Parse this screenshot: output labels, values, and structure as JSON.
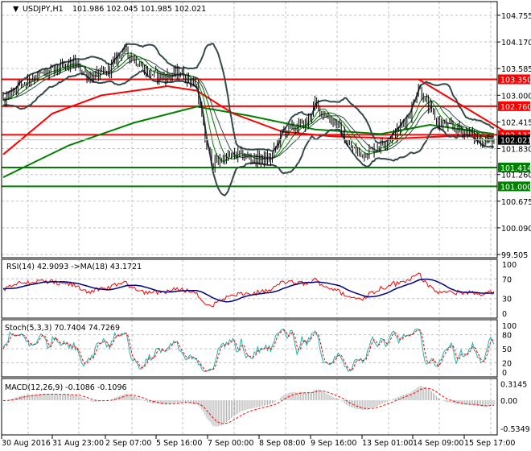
{
  "header": {
    "symbol": "USDJPY,H1",
    "ohlc": "101.986 102.045 101.985 102.021"
  },
  "chart_data": {
    "type": "candlestick",
    "symbol": "USDJPY",
    "timeframe": "H1",
    "price_axis": {
      "ticks": [
        "104.755",
        "104.170",
        "103.585",
        "103.000",
        "102.415",
        "101.830",
        "101.260",
        "100.675",
        "100.090",
        "99.505"
      ],
      "range": [
        99.505,
        104.755
      ]
    },
    "time_axis": [
      "30 Aug 2016",
      "31 Aug 23:00",
      "2 Sep 07:00",
      "5 Sep 16:00",
      "7 Sep 00:00",
      "8 Sep 08:00",
      "9 Sep 16:00",
      "13 Sep 01:00",
      "14 Sep 09:00",
      "15 Sep 17:00"
    ],
    "price_path": [
      [
        0,
        102.9
      ],
      [
        8,
        103.2
      ],
      [
        18,
        103.4
      ],
      [
        28,
        103.5
      ],
      [
        43,
        103.7
      ],
      [
        53,
        103.4
      ],
      [
        63,
        103.5
      ],
      [
        73,
        104.0
      ],
      [
        80,
        103.8
      ],
      [
        88,
        103.5
      ],
      [
        98,
        103.4
      ],
      [
        108,
        103.5
      ],
      [
        118,
        103.2
      ],
      [
        123,
        102.0
      ],
      [
        128,
        101.5
      ],
      [
        133,
        101.6
      ],
      [
        143,
        101.7
      ],
      [
        153,
        101.6
      ],
      [
        163,
        101.6
      ],
      [
        170,
        102.2
      ],
      [
        178,
        102.3
      ],
      [
        185,
        102.4
      ],
      [
        190,
        102.8
      ],
      [
        198,
        102.5
      ],
      [
        203,
        102.4
      ],
      [
        210,
        101.9
      ],
      [
        218,
        101.7
      ],
      [
        225,
        101.8
      ],
      [
        233,
        102.0
      ],
      [
        240,
        102.2
      ],
      [
        248,
        102.6
      ],
      [
        253,
        103.2
      ],
      [
        258,
        102.8
      ],
      [
        265,
        102.4
      ],
      [
        273,
        102.3
      ],
      [
        283,
        102.2
      ],
      [
        290,
        102.0
      ],
      [
        299,
        102.02
      ]
    ],
    "ma_red": [
      [
        0,
        101.7
      ],
      [
        30,
        102.6
      ],
      [
        60,
        103.0
      ],
      [
        100,
        103.2
      ],
      [
        118,
        103.1
      ],
      [
        140,
        102.6
      ],
      [
        170,
        102.2
      ],
      [
        200,
        102.1
      ],
      [
        240,
        102.05
      ],
      [
        270,
        102.1
      ],
      [
        299,
        102.1
      ]
    ],
    "ma_green": [
      [
        0,
        101.2
      ],
      [
        40,
        101.9
      ],
      [
        80,
        102.4
      ],
      [
        118,
        102.75
      ],
      [
        150,
        102.55
      ],
      [
        190,
        102.25
      ],
      [
        230,
        102.15
      ],
      [
        260,
        102.35
      ],
      [
        299,
        102.15
      ]
    ],
    "levels": [
      {
        "price": 103.35,
        "label": "103.350",
        "color": "#ff0000"
      },
      {
        "price": 102.76,
        "label": "102.760",
        "color": "#ff0000"
      },
      {
        "price": 102.132,
        "label": "102.132",
        "color": "#ff0000"
      },
      {
        "price": 101.414,
        "label": "101.414",
        "color": "#008000"
      },
      {
        "price": 101.0,
        "label": "101.000",
        "color": "#008000"
      }
    ],
    "trendline": [
      [
        253,
        103.35
      ],
      [
        306,
        102.2
      ]
    ],
    "current_price": "102.021",
    "rsi": {
      "label": "RSI(14) 42.9093  ->MA(18) 43.1721",
      "ticks": [
        "100",
        "70",
        "30",
        "0"
      ]
    },
    "stoch": {
      "label": "Stoch(5,3,3) 70.7404 74.7269",
      "ticks": [
        "100",
        "80",
        "50",
        "20",
        "0"
      ]
    },
    "macd": {
      "label": "MACD(12,26,9) -0.1086 -0.1096",
      "ticks": [
        "0.3145",
        "0.00",
        "-0.5349"
      ],
      "range": [
        -0.5349,
        0.3145
      ]
    }
  },
  "colors": {
    "red": "#ff0000",
    "green": "#008000",
    "band": "#34494a",
    "rsi_ma": "#000080",
    "stoch_main": "#20b2aa"
  }
}
